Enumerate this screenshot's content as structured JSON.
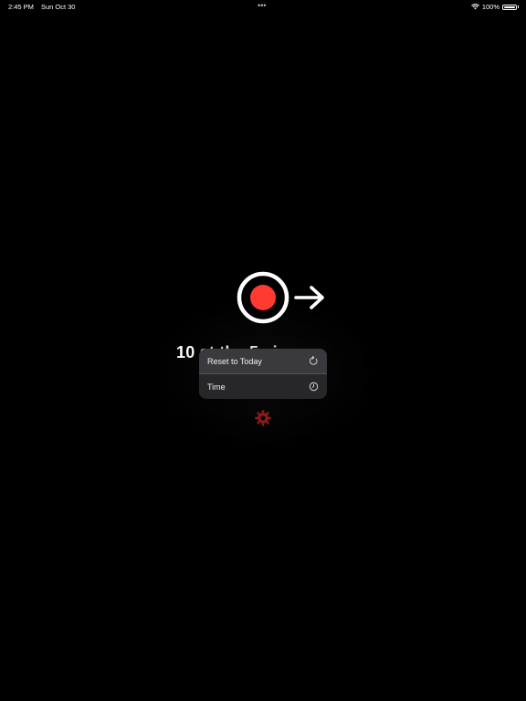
{
  "status_bar": {
    "time": "2:45 PM",
    "date": "Sun Oct 30",
    "multitask_dots": "•••",
    "battery_text": "100%",
    "icons": [
      "wifi-icon",
      "battery-icon"
    ]
  },
  "main": {
    "title": "10 at the 5 since",
    "icons": [
      "record-icon",
      "arrow-right-icon",
      "gear-icon"
    ]
  },
  "context_menu": {
    "items": [
      {
        "label": "Reset to Today",
        "icon": "reset-icon"
      },
      {
        "label": "Time",
        "icon": "clock-icon"
      }
    ]
  },
  "colors": {
    "background": "#000000",
    "record_red": "#ff3b30",
    "gear_red": "#8b1a1a",
    "menu_bg": "#28282a"
  }
}
